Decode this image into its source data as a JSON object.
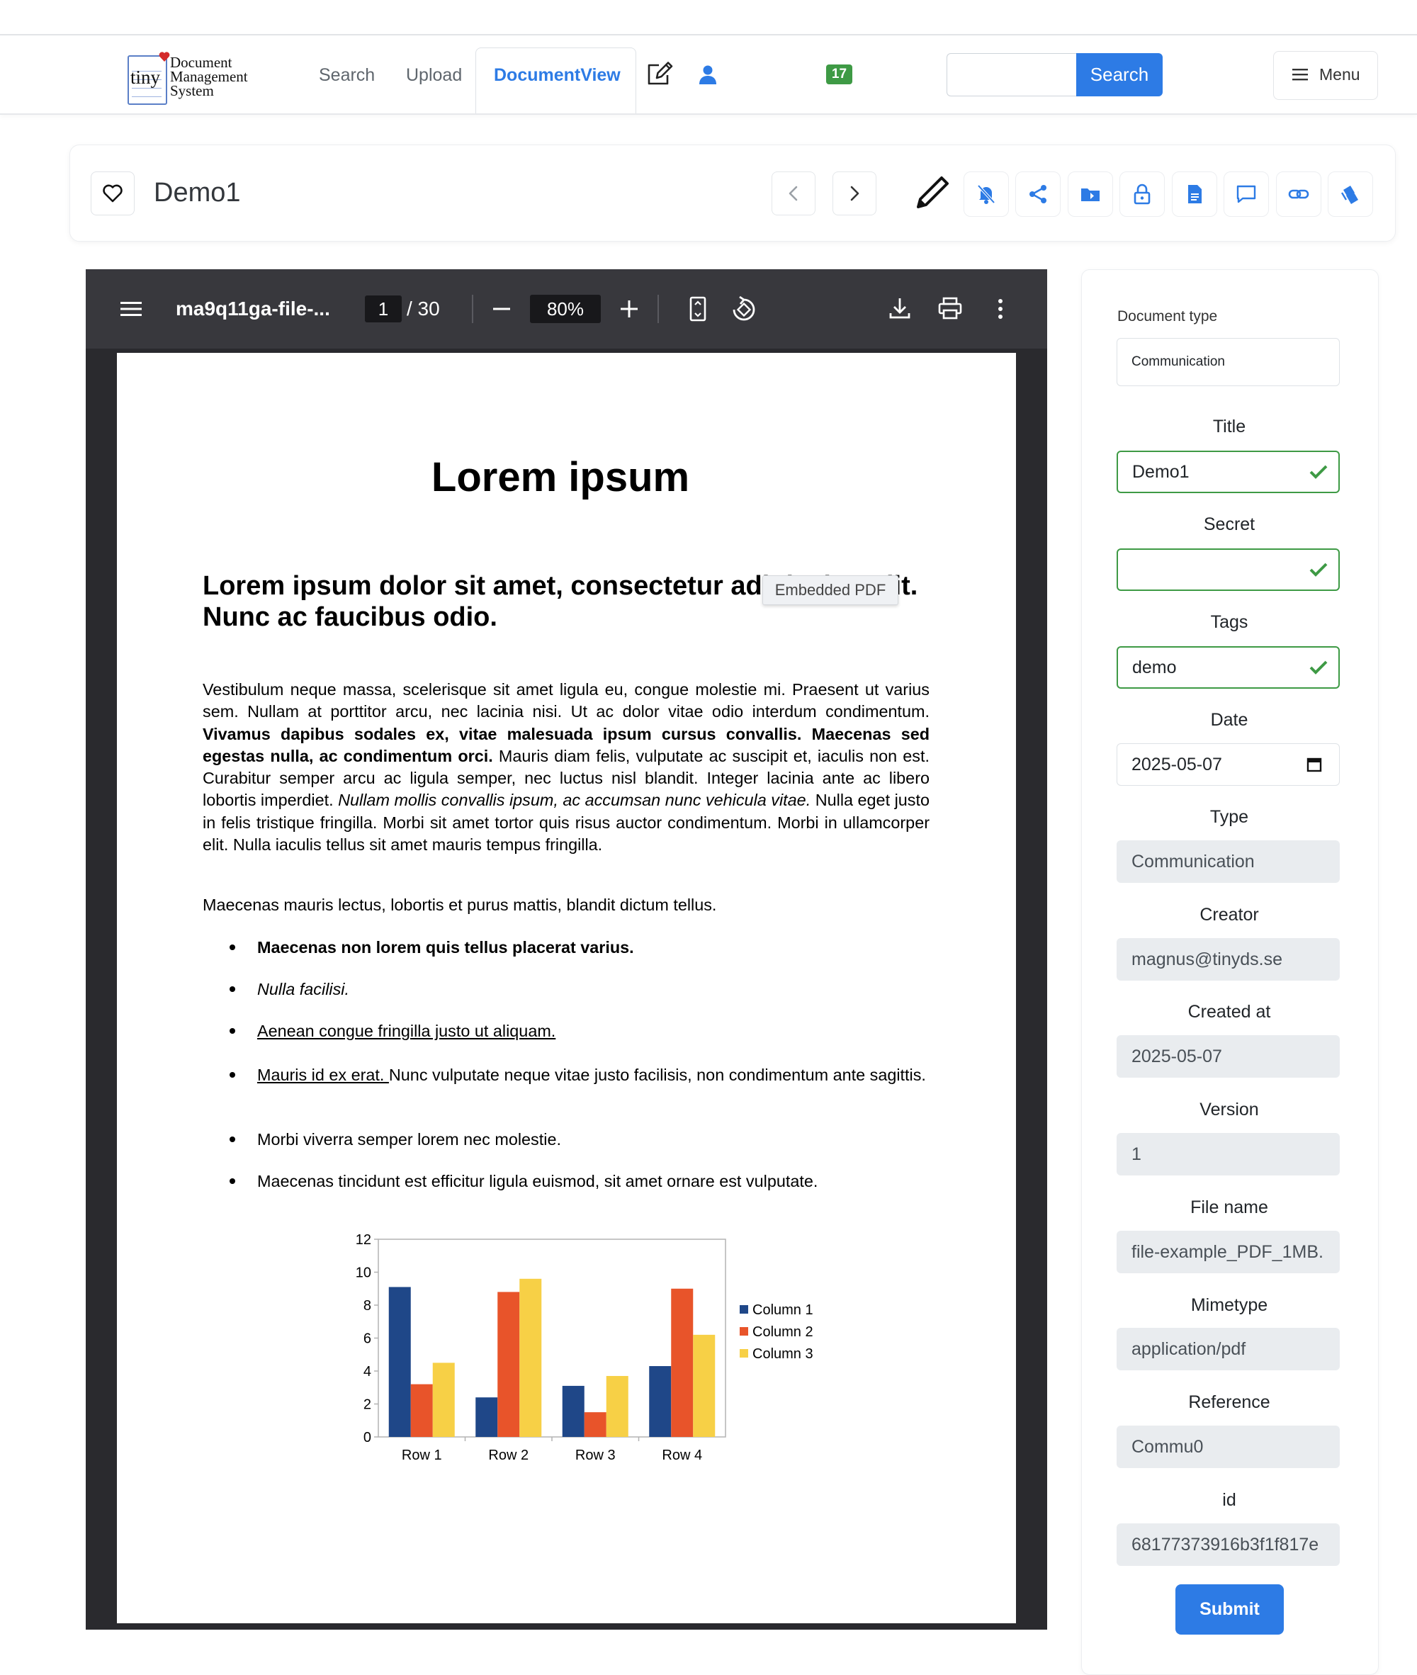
{
  "app": {
    "logo": {
      "tiny": "tiny",
      "line1": "Document",
      "line2": "Management",
      "line3": "System"
    },
    "nav": {
      "search": "Search",
      "upload": "Upload",
      "document_view": "DocumentView"
    },
    "badge_count": "17",
    "search_button": "Search",
    "menu_label": "Menu"
  },
  "doc_header": {
    "title": "Demo1"
  },
  "viewer": {
    "file_name": "ma9q11ga-file-...",
    "page_current": "1",
    "page_total": "/ 30",
    "zoom": "80%",
    "tooltip": "Embedded PDF",
    "page": {
      "h1": "Lorem ipsum",
      "h2": "Lorem ipsum dolor sit amet, consectetur adipiscing elit. Nunc ac faucibus odio.",
      "p1_a": "Vestibulum neque massa, scelerisque sit amet ligula eu, congue molestie mi. Praesent ut varius sem. Nullam at porttitor arcu, nec lacinia nisi. Ut ac dolor vitae odio interdum condimentum. ",
      "p1_bold": "Vivamus dapibus sodales ex, vitae malesuada ipsum cursus convallis. Maecenas sed egestas nulla, ac condimentum orci.",
      "p1_b": " Mauris diam felis, vulputate ac suscipit et, iaculis non est. Curabitur semper arcu ac ligula semper, nec luctus nisl blandit. Integer lacinia ante ac libero lobortis imperdiet. ",
      "p1_italic": "Nullam mollis convallis ipsum, ac accumsan nunc vehicula vitae.",
      "p1_c": " Nulla eget justo in felis tristique fringilla. Morbi sit amet tortor quis risus auctor condimentum. Morbi in ullamcorper elit. Nulla iaculis tellus sit amet mauris tempus fringilla.",
      "p2": "Maecenas mauris lectus, lobortis et purus mattis, blandit dictum tellus.",
      "b1": "Maecenas non lorem quis tellus placerat varius.",
      "b2": "Nulla facilisi.",
      "b3": "Aenean congue fringilla justo ut aliquam. ",
      "b4_link": "Mauris id ex erat. ",
      "b4_rest": "Nunc vulputate neque vitae justo facilisis, non condimentum ante sagittis.",
      "b5": "Morbi viverra semper lorem nec molestie.",
      "b6": "Maecenas tincidunt est efficitur ligula euismod, sit amet ornare est vulputate."
    }
  },
  "chart_data": {
    "type": "bar",
    "categories": [
      "Row 1",
      "Row 2",
      "Row 3",
      "Row 4"
    ],
    "series": [
      {
        "name": "Column 1",
        "values": [
          9.1,
          2.4,
          3.1,
          4.3
        ],
        "color": "#1f4788"
      },
      {
        "name": "Column 2",
        "values": [
          3.2,
          8.8,
          1.5,
          9.0
        ],
        "color": "#e8542a"
      },
      {
        "name": "Column 3",
        "values": [
          4.5,
          9.6,
          3.7,
          6.2
        ],
        "color": "#f7d046"
      }
    ],
    "yticks": [
      "0",
      "2",
      "4",
      "6",
      "8",
      "10",
      "12"
    ],
    "ylim": [
      0,
      12
    ],
    "grid": false,
    "legend": "right",
    "title": "",
    "xlabel": "",
    "ylabel": ""
  },
  "form": {
    "doc_type_label": "Document type",
    "doc_type_value": "Communication",
    "title_label": "Title",
    "title_value": "Demo1",
    "secret_label": "Secret",
    "secret_value": "",
    "tags_label": "Tags",
    "tags_value": "demo",
    "date_label": "Date",
    "date_value": "2025-05-07",
    "type_label": "Type",
    "type_value": "Communication",
    "creator_label": "Creator",
    "creator_value": "magnus@tinyds.se",
    "created_label": "Created at",
    "created_value": "2025-05-07",
    "version_label": "Version",
    "version_value": "1",
    "filename_label": "File name",
    "filename_value": "file-example_PDF_1MB.",
    "mimetype_label": "Mimetype",
    "mimetype_value": "application/pdf",
    "reference_label": "Reference",
    "reference_value": "Commu0",
    "id_label": "id",
    "id_value": "68177373916b3f1f817e",
    "submit": "Submit"
  },
  "colors": {
    "accent": "#2d7be5",
    "valid": "#3e9a45",
    "viewer_bg": "#2a2a2e",
    "viewer_toolbar": "#38383d"
  }
}
